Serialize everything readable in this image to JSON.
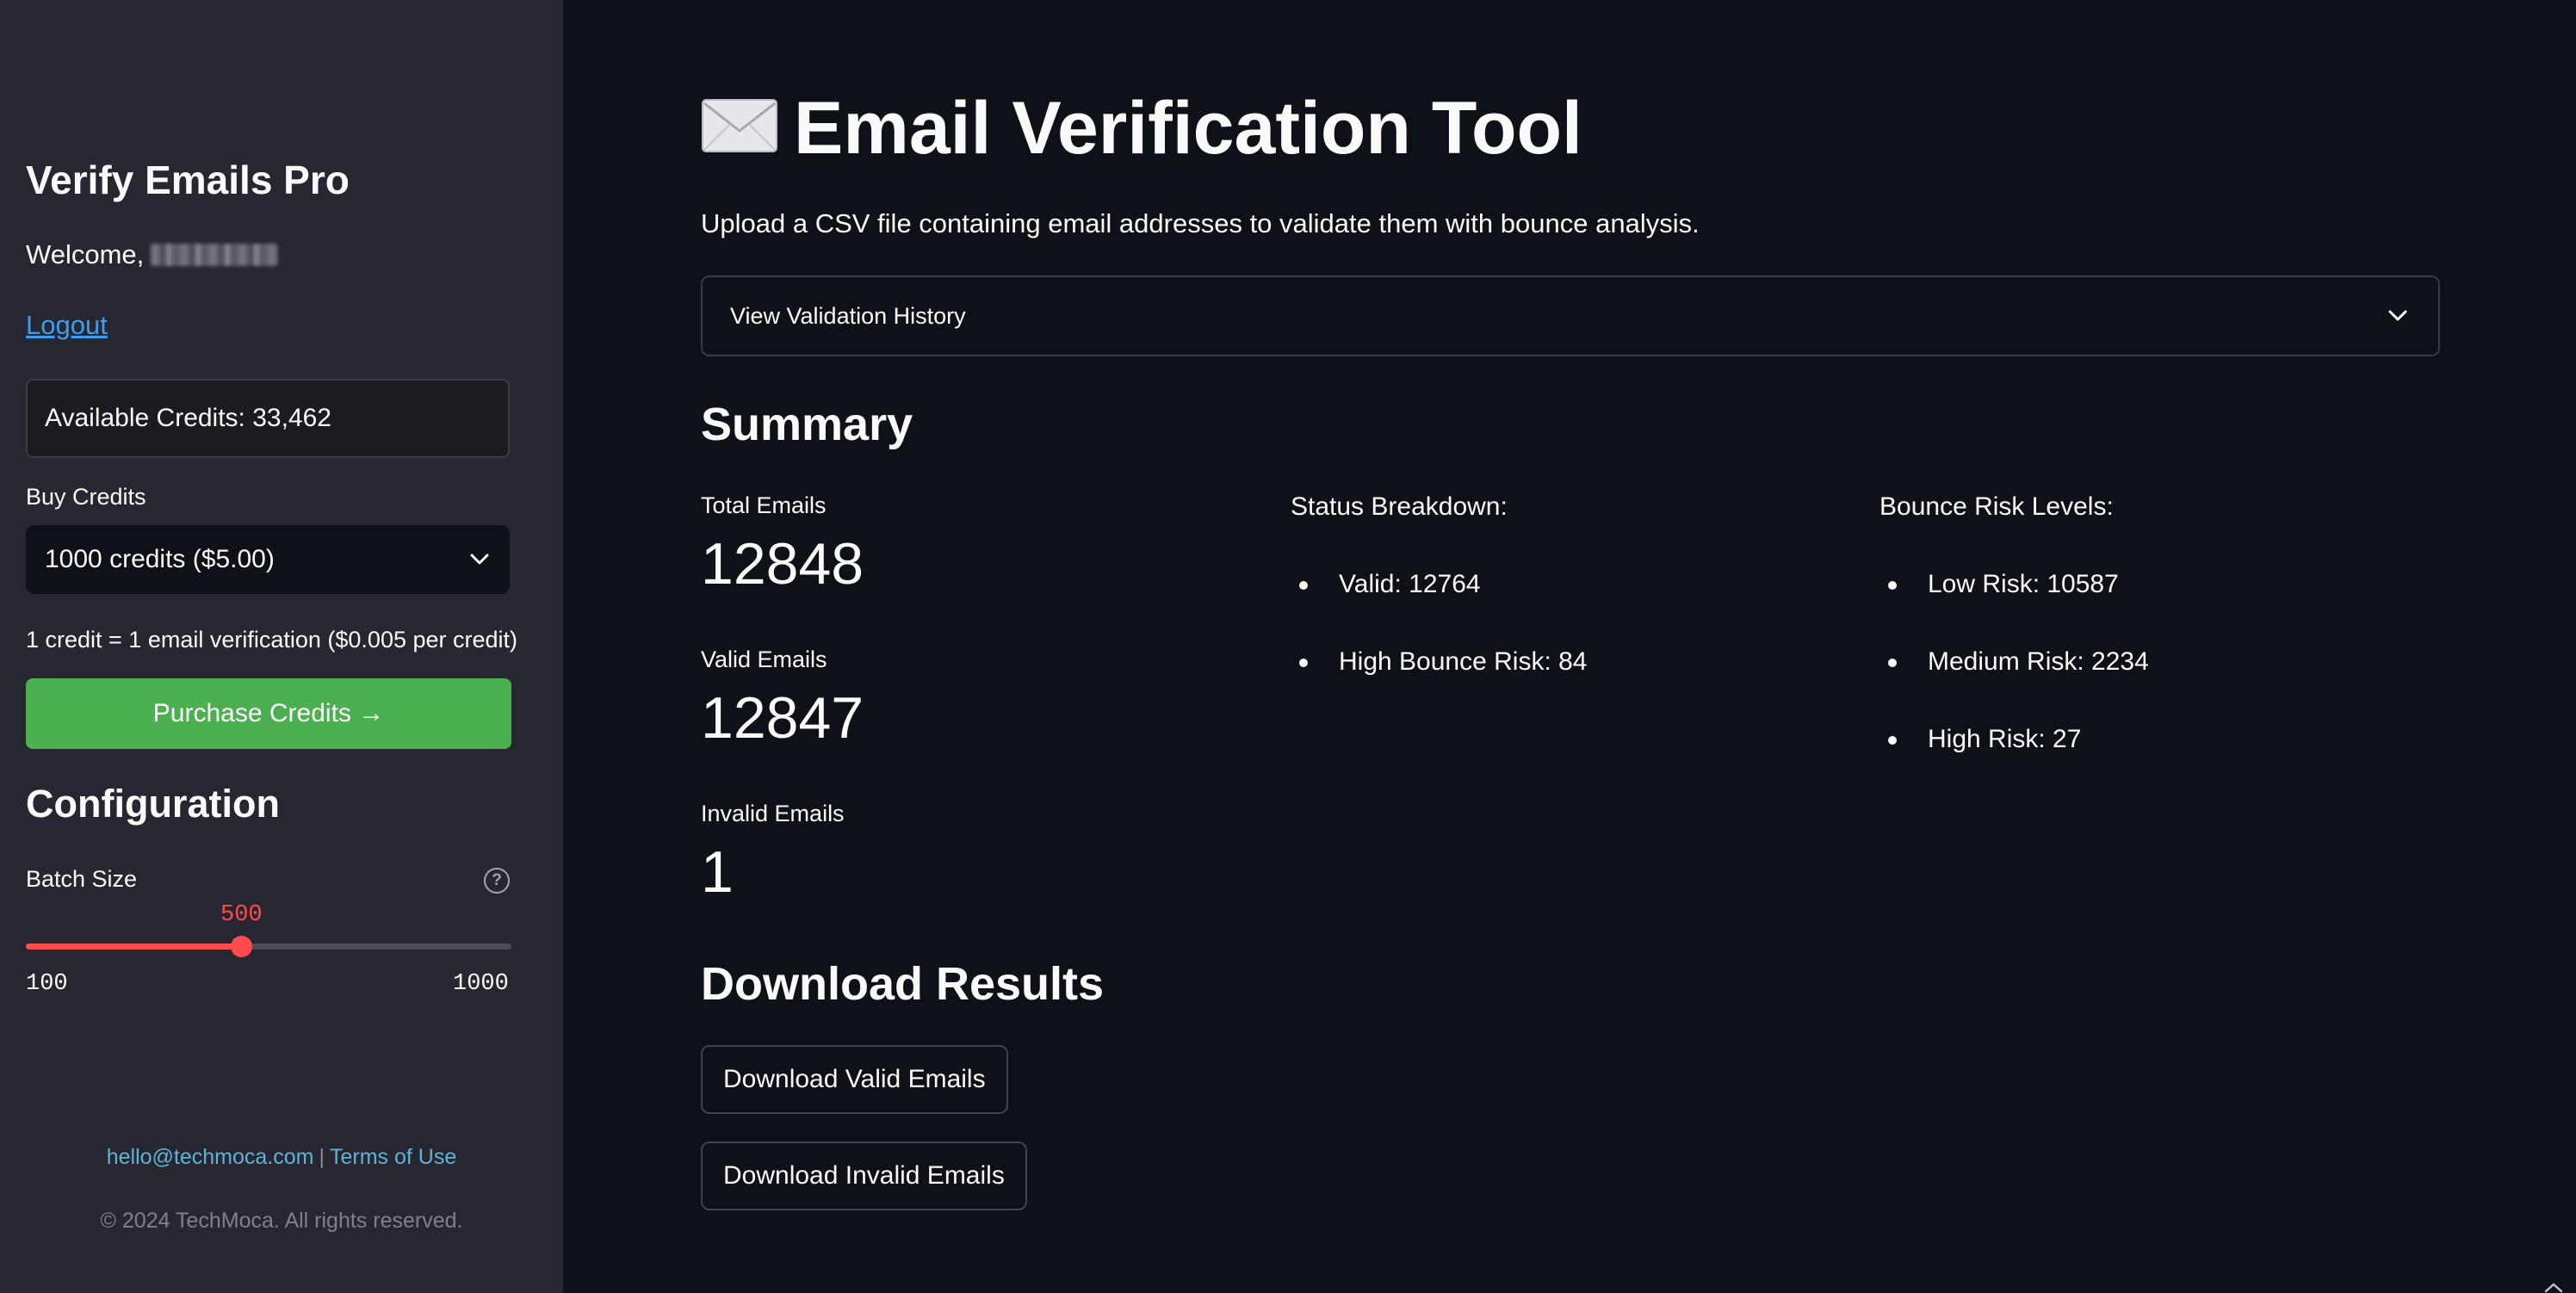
{
  "sidebar": {
    "brand": "Verify Emails Pro",
    "welcome_prefix": "Welcome,",
    "logout_label": "Logout",
    "credits_text": "Available Credits: 33,462",
    "buy_label": "Buy Credits",
    "selected_package": "1000 credits ($5.00)",
    "rate_note": "1 credit = 1 email verification ($0.005 per credit)",
    "purchase_label": "Purchase Credits →",
    "config_title": "Configuration",
    "batch_label": "Batch Size",
    "slider": {
      "value": "500",
      "min": "100",
      "max": "1000",
      "fraction": 0.444
    },
    "footer": {
      "email": "hello@techmoca.com",
      "separator": "|",
      "terms": "Terms of Use",
      "copyright": "© 2024 TechMoca. All rights reserved."
    }
  },
  "main": {
    "title_icon": "envelope-icon",
    "title": "Email Verification Tool",
    "subtitle": "Upload a CSV file containing email addresses to validate them with bounce analysis.",
    "history_label": "View Validation History",
    "summary_title": "Summary",
    "metrics": [
      {
        "label": "Total Emails",
        "value": "12848"
      },
      {
        "label": "Valid Emails",
        "value": "12847"
      },
      {
        "label": "Invalid Emails",
        "value": "1"
      }
    ],
    "status_breakdown": {
      "heading": "Status Breakdown:",
      "items": [
        "Valid: 12764",
        "High Bounce Risk: 84"
      ]
    },
    "bounce_risk": {
      "heading": "Bounce Risk Levels:",
      "items": [
        "Low Risk: 10587",
        "Medium Risk: 2234",
        "High Risk: 27"
      ]
    },
    "download_title": "Download Results",
    "download_valid_label": "Download Valid Emails",
    "download_invalid_label": "Download Invalid Emails"
  },
  "colors": {
    "background": "#0e1117",
    "sidebar": "#262730",
    "accent_red": "#ff4b4b",
    "purchase_green": "#4caf50",
    "link_blue": "#3d9df3",
    "footer_link": "#5fb2d8"
  }
}
